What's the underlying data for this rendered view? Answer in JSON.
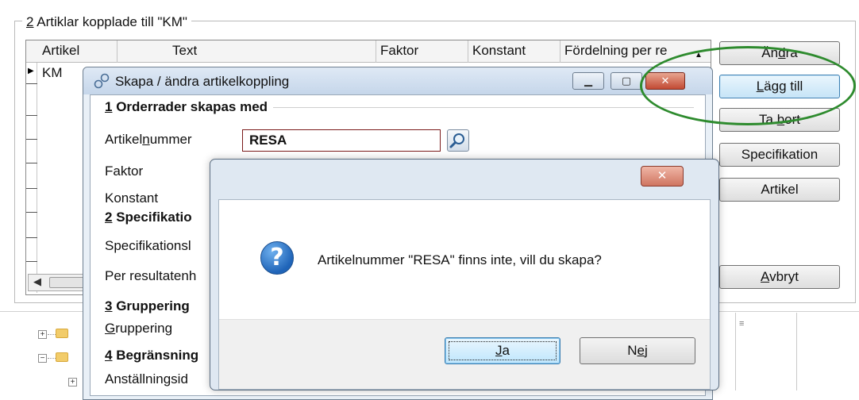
{
  "main": {
    "group_title_num": "2",
    "group_title_rest": " Artiklar kopplade till  \"KM\"",
    "columns": [
      "Artikel",
      "Text",
      "Faktor",
      "Konstant",
      "Fördelning per re"
    ],
    "rows": [
      {
        "artikel": "KM"
      }
    ],
    "buttons": {
      "andra_pre": "Än",
      "andra_ul": "d",
      "andra_post": "ra",
      "lagg_ul": "L",
      "lagg_post": "ägg till",
      "tabort_pre": "Ta ",
      "tabort_ul": "b",
      "tabort_post": "ort",
      "specifikation": "Specifikation",
      "artikel": "Artikel",
      "avbryt_ul": "A",
      "avbryt_post": "vbryt"
    },
    "highlight_color": "#2e8b2e"
  },
  "dialog": {
    "title": "Skapa / ändra artikelkoppling",
    "sections": {
      "s1_num": "1",
      "s1_rest": " Orderrader skapas med",
      "s2_num": "2",
      "s2_rest": " Specifikatio",
      "s3_num": "3",
      "s3_rest": " Gruppering",
      "s4_num": "4",
      "s4_rest": " Begränsning"
    },
    "labels": {
      "artikelnummer_pre": "Artikel",
      "artikelnummer_ul": "n",
      "artikelnummer_post": "ummer",
      "faktor": "Faktor",
      "konstant": "Konstant",
      "specifikation": "Specifikationsl",
      "per_resultat": "Per resultatenh",
      "gruppering_ul": "G",
      "gruppering_post": "ruppering",
      "anstallning": "Anställningsid"
    },
    "artikelnummer_value": "RESA"
  },
  "messagebox": {
    "message": "Artikelnummer \"RESA\" finns inte, vill du skapa?",
    "yes_ul": "J",
    "yes_post": "a",
    "no_pre": "N",
    "no_ul": "e",
    "no_post": "j"
  }
}
